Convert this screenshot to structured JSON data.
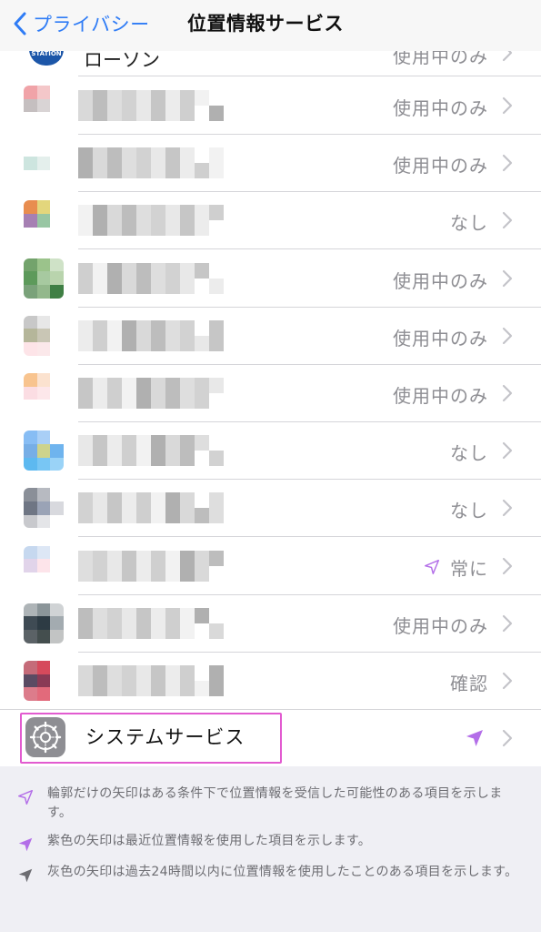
{
  "navbar": {
    "back_label": "プライバシー",
    "title": "位置情報サービス"
  },
  "partial_row": {
    "icon_text": "STATION",
    "name": "ローソン",
    "status": "使用中のみ"
  },
  "apps": [
    {
      "status": "使用中のみ",
      "icon": [
        "#f0a3a8",
        "#f4c7c9",
        "#ffffff",
        "#c5bfc0",
        "#d9d4d5",
        "#ffffff",
        "#ffffff",
        "#ffffff",
        "#ffffff"
      ]
    },
    {
      "status": "使用中のみ",
      "icon": [
        "#ffffff",
        "#ffffff",
        "#ffffff",
        "#cde5df",
        "#e4efec",
        "#ffffff",
        "#ffffff",
        "#ffffff",
        "#ffffff"
      ]
    },
    {
      "status": "なし",
      "icon": [
        "#e88d4f",
        "#e3d67c",
        "#ffffff",
        "#a680b3",
        "#98c6a3",
        "#ffffff",
        "#ffffff",
        "#ffffff",
        "#ffffff"
      ]
    },
    {
      "status": "使用中のみ",
      "icon": [
        "#73a36c",
        "#9bc38b",
        "#cfe2c7",
        "#5d9a5b",
        "#a7c9a0",
        "#b9d4ad",
        "#7aa27a",
        "#93b88c",
        "#3f7f44"
      ]
    },
    {
      "status": "使用中のみ",
      "icon": [
        "#c8c8c8",
        "#e7e7e7",
        "#ffffff",
        "#b5b69a",
        "#c9c6b5",
        "#ffffff",
        "#fde4e8",
        "#fbe8ea",
        "#ffffff"
      ]
    },
    {
      "status": "使用中のみ",
      "icon": [
        "#f8c48f",
        "#fbe2cf",
        "#ffffff",
        "#fbdde3",
        "#fde7ea",
        "#ffffff",
        "#ffffff",
        "#ffffff",
        "#ffffff"
      ]
    },
    {
      "status": "なし",
      "icon": [
        "#87bdf4",
        "#a9cff6",
        "#ffffff",
        "#77aee6",
        "#cdd38c",
        "#6fb4ee",
        "#5db9f0",
        "#78c6f4",
        "#9ad3f7"
      ]
    },
    {
      "status": "なし",
      "icon": [
        "#8a8f98",
        "#b7bac1",
        "#ffffff",
        "#6f7684",
        "#9aa3b6",
        "#d8d9de",
        "#c8c9cd",
        "#e4e5e8",
        "#ffffff"
      ]
    },
    {
      "status": "常に",
      "location_arrow": "hollow-purple",
      "icon": [
        "#c6d8ef",
        "#dde7f5",
        "#ffffff",
        "#e1d4ea",
        "#fde4ea",
        "#ffffff",
        "#ffffff",
        "#ffffff",
        "#ffffff"
      ]
    },
    {
      "status": "使用中のみ",
      "icon": [
        "#aeb4b7",
        "#8b9599",
        "#d0d3d5",
        "#3f4b54",
        "#2d3b44",
        "#a3abb0",
        "#5b6266",
        "#444e4e",
        "#c2c4c4"
      ]
    },
    {
      "status": "確認",
      "icon": [
        "#c56b79",
        "#d64a5c",
        "#ffffff",
        "#5a4b63",
        "#8a3a55",
        "#ffffff",
        "#dc7c8b",
        "#e26a7b",
        "#ffffff"
      ]
    }
  ],
  "system_services": {
    "label": "システムサービス",
    "location_arrow": "solid-purple"
  },
  "legend": [
    {
      "icon": "hollow-purple-arrow-icon",
      "text": "輪郭だけの矢印はある条件下で位置情報を受信した可能性のある項目を示します。"
    },
    {
      "icon": "solid-purple-arrow-icon",
      "text": "紫色の矢印は最近位置情報を使用した項目を示します。"
    },
    {
      "icon": "solid-gray-arrow-icon",
      "text": "灰色の矢印は過去24時間以内に位置情報を使用したことのある項目を示します。"
    }
  ],
  "colors": {
    "accent_blue": "#2f7cf6",
    "arrow_purple": "#b36ee8",
    "arrow_gray": "#6d6d72",
    "highlight_pink": "#e25bd0",
    "secondary_text": "#8e8e93"
  }
}
